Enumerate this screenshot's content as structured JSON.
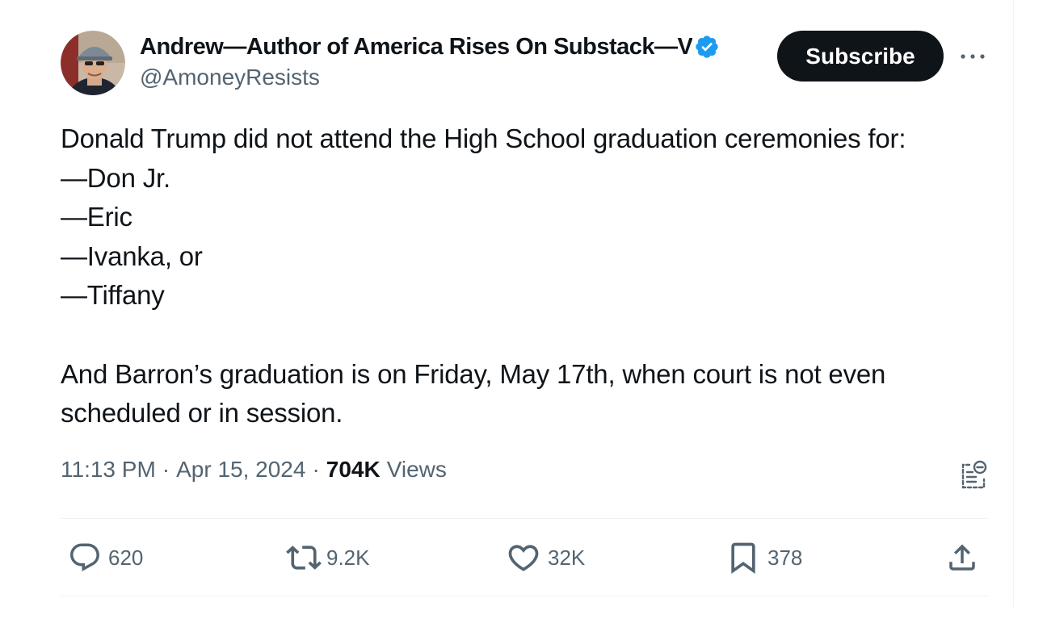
{
  "author": {
    "display_name": "Andrew—Author of America Rises On Substack—V",
    "handle": "@AmoneyResists",
    "verified": true
  },
  "header": {
    "subscribe_label": "Subscribe"
  },
  "tweet": {
    "lines": [
      "Donald Trump did not attend the High School graduation ceremonies for:",
      "—Don Jr.",
      "—Eric",
      "—Ivanka, or",
      "—Tiffany",
      "And Barron’s graduation is on Friday, May 17th, when court is not even",
      "scheduled or in session."
    ]
  },
  "meta": {
    "time": "11:13 PM",
    "separator": "·",
    "date": "Apr 15, 2024",
    "views_count": "704K",
    "views_label": "Views"
  },
  "actions": {
    "replies": "620",
    "reposts": "9.2K",
    "likes": "32K",
    "bookmarks": "378"
  },
  "colors": {
    "text_primary": "#0f1419",
    "text_secondary": "#536471",
    "verified_blue": "#1d9bf0",
    "divider": "#eff3f4",
    "button_bg": "#0f1419"
  },
  "icons": {
    "verified": "verified-badge-icon",
    "more": "more-icon",
    "analytics": "analytics-icon",
    "reply": "reply-icon",
    "repost": "repost-icon",
    "like": "heart-icon",
    "bookmark": "bookmark-icon",
    "share": "share-icon"
  }
}
